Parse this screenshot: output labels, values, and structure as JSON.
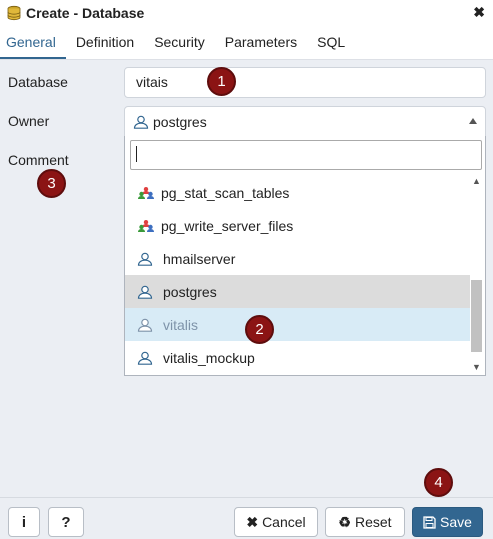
{
  "dialog": {
    "title": "Create - Database"
  },
  "tabs": [
    {
      "label": "General",
      "active": true
    },
    {
      "label": "Definition"
    },
    {
      "label": "Security"
    },
    {
      "label": "Parameters"
    },
    {
      "label": "SQL"
    }
  ],
  "form": {
    "database_label": "Database",
    "database_value": "vitais",
    "owner_label": "Owner",
    "owner_value": "postgres",
    "comment_label": "Comment"
  },
  "dropdown": {
    "search_value": "",
    "options": [
      {
        "label": "pg_stat_scan_tables",
        "icon": "group-roles-icon"
      },
      {
        "label": "pg_write_server_files",
        "icon": "group-roles-icon"
      },
      {
        "label": "hmailserver",
        "icon": "user-icon"
      },
      {
        "label": "postgres",
        "icon": "user-icon",
        "state": "hover"
      },
      {
        "label": "vitalis",
        "icon": "user-icon",
        "state": "selected"
      },
      {
        "label": "vitalis_mockup",
        "icon": "user-icon"
      }
    ]
  },
  "annotations": [
    "1",
    "2",
    "3",
    "4"
  ],
  "footer": {
    "info_label": "i",
    "help_label": "?",
    "cancel_label": "Cancel",
    "reset_label": "Reset",
    "save_label": "Save"
  },
  "colors": {
    "accent": "#326690",
    "badge": "#8b1414",
    "selected_bg": "#d8ebf6",
    "hover_bg": "#dcdcdc",
    "background": "#ebeef3"
  }
}
